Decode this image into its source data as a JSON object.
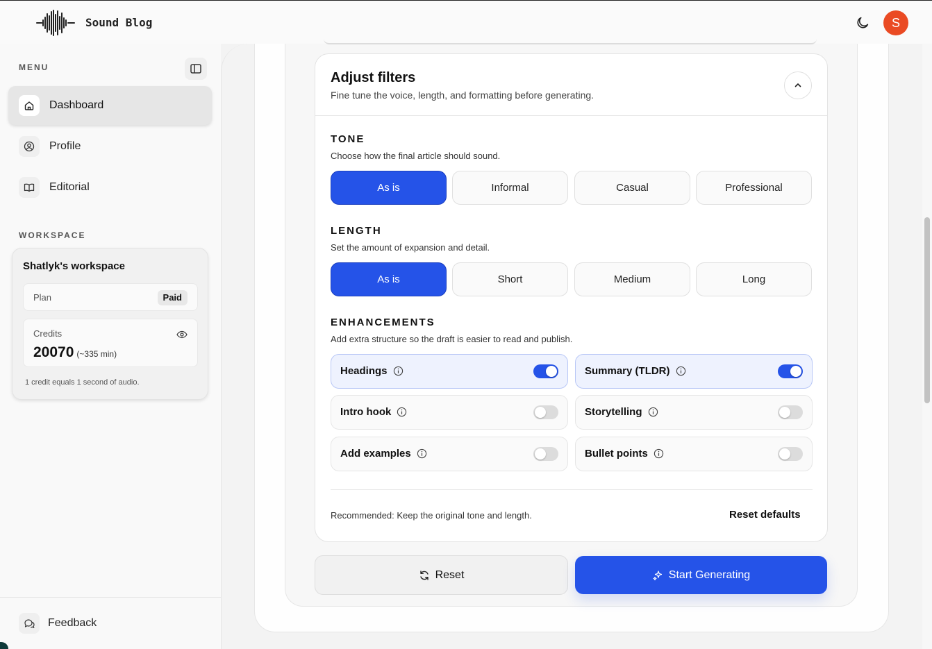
{
  "app": {
    "brand": "Sound Blog",
    "avatar_initial": "S",
    "accent_color": "#2553e8",
    "avatar_color": "#ea4a23"
  },
  "sidebar": {
    "menu_title": "MENU",
    "items": [
      {
        "label": "Dashboard",
        "icon": "home-icon",
        "active": true
      },
      {
        "label": "Profile",
        "icon": "user-circle-icon",
        "active": false
      },
      {
        "label": "Editorial",
        "icon": "book-open-icon",
        "active": false
      }
    ],
    "workspace_title": "WORKSPACE",
    "workspace": {
      "name": "Shatlyk's workspace",
      "plan_label": "Plan",
      "plan_value": "Paid",
      "credits_label": "Credits",
      "credits_value": "20070",
      "credits_minutes": "(~335 min)",
      "note": "1 credit equals 1 second of audio."
    },
    "feedback_label": "Feedback"
  },
  "filters": {
    "title": "Adjust filters",
    "subtitle": "Fine tune the voice, length, and formatting before generating.",
    "tone": {
      "title": "TONE",
      "description": "Choose how the final article should sound.",
      "options": [
        "As is",
        "Informal",
        "Casual",
        "Professional"
      ],
      "selected": "As is"
    },
    "length": {
      "title": "LENGTH",
      "description": "Set the amount of expansion and detail.",
      "options": [
        "As is",
        "Short",
        "Medium",
        "Long"
      ],
      "selected": "As is"
    },
    "enhancements": {
      "title": "ENHANCEMENTS",
      "description": "Add extra structure so the draft is easier to read and publish.",
      "items": [
        {
          "label": "Headings",
          "enabled": true
        },
        {
          "label": "Summary (TLDR)",
          "enabled": true
        },
        {
          "label": "Intro hook",
          "enabled": false
        },
        {
          "label": "Storytelling",
          "enabled": false
        },
        {
          "label": "Add examples",
          "enabled": false
        },
        {
          "label": "Bullet points",
          "enabled": false
        }
      ]
    },
    "recommendation": "Recommended: Keep the original tone and length.",
    "reset_defaults_label": "Reset defaults"
  },
  "actions": {
    "reset_label": "Reset",
    "start_label": "Start Generating"
  }
}
